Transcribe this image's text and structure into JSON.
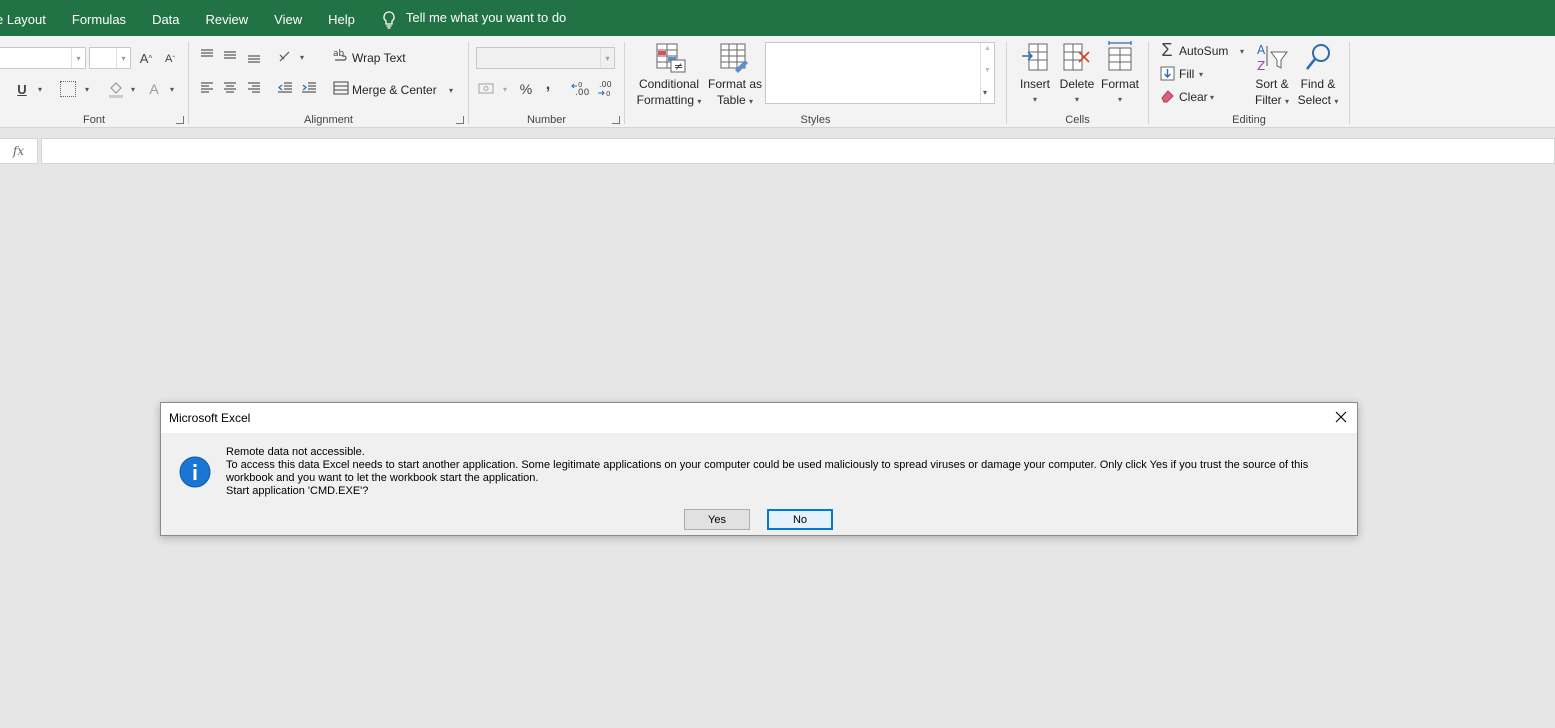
{
  "tabs": [
    "e Layout",
    "Formulas",
    "Data",
    "Review",
    "View",
    "Help"
  ],
  "tell_me": "Tell me what you want to do",
  "ribbon": {
    "font_group": "Font",
    "alignment_group": "Alignment",
    "wrap_text": "Wrap Text",
    "merge_center": "Merge & Center",
    "number_group": "Number",
    "percent": "%",
    "comma": ",",
    "conditional_formatting": [
      "Conditional",
      "Formatting"
    ],
    "format_as_table": [
      "Format as",
      "Table"
    ],
    "styles_group": "Styles",
    "insert": "Insert",
    "delete": "Delete",
    "format": "Format",
    "cells_group": "Cells",
    "autosum": "AutoSum",
    "fill": "Fill",
    "clear": "Clear",
    "sort_filter": [
      "Sort &",
      "Filter"
    ],
    "find_select": [
      "Find &",
      "Select"
    ],
    "editing_group": "Editing",
    "increase_font": "A",
    "decrease_font": "A",
    "underline": "U",
    "font_color": "A"
  },
  "formula_bar": {
    "fx": "fx",
    "value": ""
  },
  "dialog": {
    "title": "Microsoft Excel",
    "line1": "Remote data not accessible.",
    "line2": "To access this data Excel needs to start another application. Some legitimate applications on your computer could be used maliciously to spread viruses or damage your computer. Only click Yes if you trust the source of this workbook and you want to let the workbook start the application.",
    "line3": "Start application 'CMD.EXE'?",
    "yes": "Yes",
    "no": "No"
  },
  "colors": {
    "accent": "#217346",
    "info": "#0078d7"
  }
}
